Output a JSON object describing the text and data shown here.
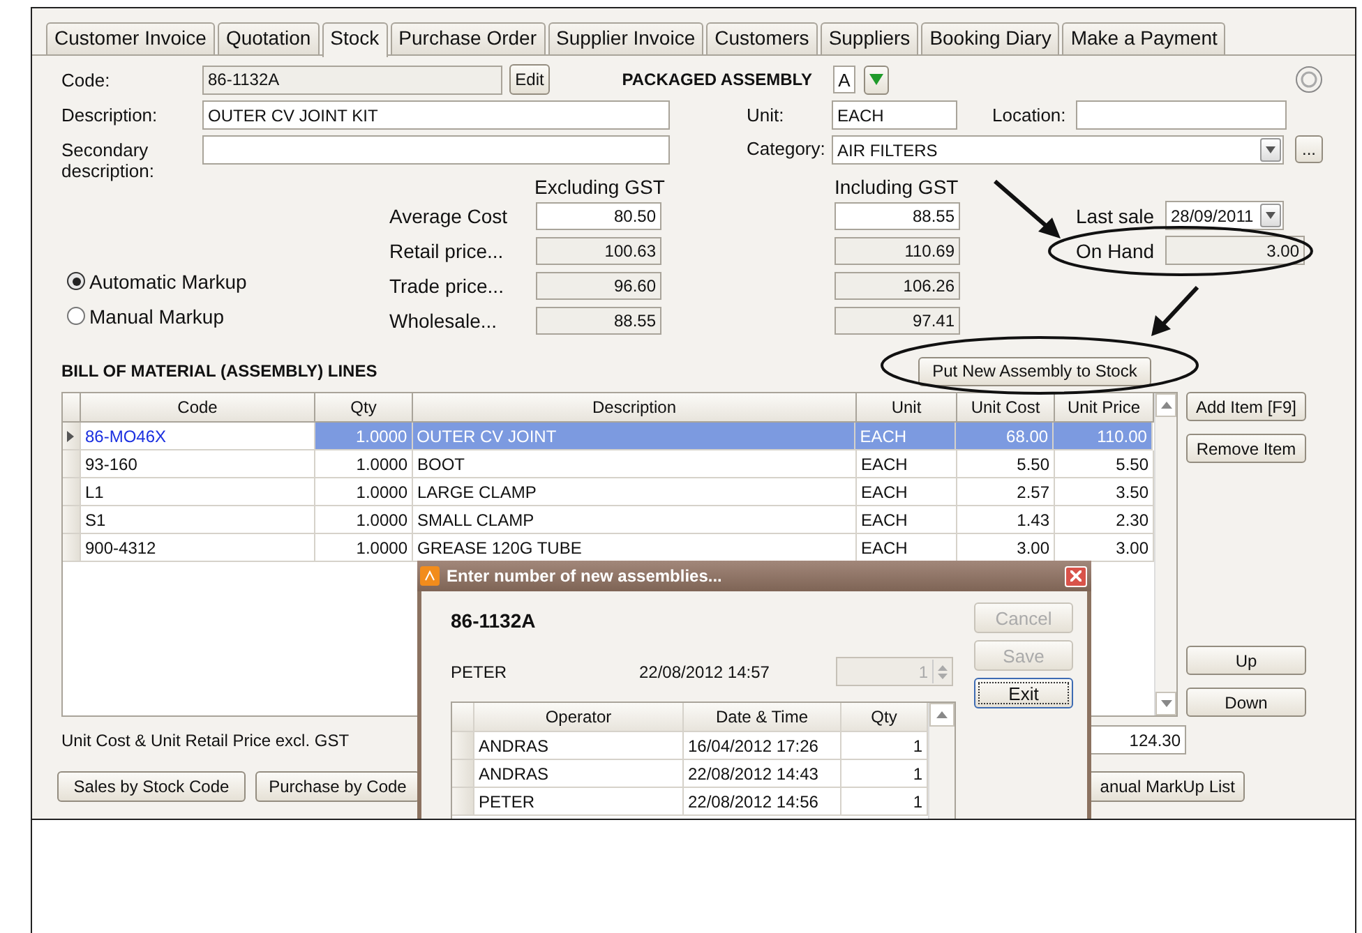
{
  "tabs": [
    {
      "label": "Customer Invoice",
      "selected": false
    },
    {
      "label": "Quotation",
      "selected": false
    },
    {
      "label": "Stock",
      "selected": true
    },
    {
      "label": "Purchase Order",
      "selected": false
    },
    {
      "label": "Supplier Invoice",
      "selected": false
    },
    {
      "label": "Customers",
      "selected": false
    },
    {
      "label": "Suppliers",
      "selected": false
    },
    {
      "label": "Booking Diary",
      "selected": false
    },
    {
      "label": "Make a Payment",
      "selected": false
    }
  ],
  "stock": {
    "code_label": "Code:",
    "code": "86-1132A",
    "edit_button": "Edit",
    "type_label": "PACKAGED ASSEMBLY",
    "type_code": "A",
    "description_label": "Description:",
    "description": "OUTER CV JOINT KIT",
    "unit_label": "Unit:",
    "unit": "EACH",
    "location_label": "Location:",
    "secondary_description_label": "Secondary description:",
    "category_label": "Category:",
    "category": "AIR FILTERS",
    "more_button": "...",
    "excluding_header": "Excluding GST",
    "including_header": "Including GST",
    "prices": [
      {
        "label": "Average Cost",
        "excluding": "80.50",
        "including": "88.55",
        "editable": true
      },
      {
        "label": "Retail price...",
        "excluding": "100.63",
        "including": "110.69",
        "editable": false
      },
      {
        "label": "Trade price...",
        "excluding": "96.60",
        "including": "106.26",
        "editable": false
      },
      {
        "label": "Wholesale...",
        "excluding": "88.55",
        "including": "97.41",
        "editable": false
      }
    ],
    "markup_options": [
      {
        "label": "Automatic Markup",
        "selected": true
      },
      {
        "label": "Manual Markup",
        "selected": false
      }
    ],
    "last_sale_label": "Last sale",
    "last_sale": "28/09/2011",
    "on_hand_label": "On Hand",
    "on_hand": "3.00"
  },
  "bom": {
    "title": "BILL OF MATERIAL (ASSEMBLY) LINES",
    "action_button": "Put New Assembly to Stock",
    "columns": [
      "Code",
      "Qty",
      "Description",
      "Unit",
      "Unit Cost",
      "Unit Price"
    ],
    "rows": [
      {
        "code": "86-MO46X",
        "qty": "1.0000",
        "description": "OUTER CV JOINT",
        "unit": "EACH",
        "unit_cost": "68.00",
        "unit_price": "110.00",
        "selected": true
      },
      {
        "code": "93-160",
        "qty": "1.0000",
        "description": "BOOT",
        "unit": "EACH",
        "unit_cost": "5.50",
        "unit_price": "5.50",
        "selected": false
      },
      {
        "code": "L1",
        "qty": "1.0000",
        "description": "LARGE CLAMP",
        "unit": "EACH",
        "unit_cost": "2.57",
        "unit_price": "3.50",
        "selected": false
      },
      {
        "code": "S1",
        "qty": "1.0000",
        "description": "SMALL CLAMP",
        "unit": "EACH",
        "unit_cost": "1.43",
        "unit_price": "2.30",
        "selected": false
      },
      {
        "code": "900-4312",
        "qty": "1.0000",
        "description": "GREASE 120G TUBE",
        "unit": "EACH",
        "unit_cost": "3.00",
        "unit_price": "3.00",
        "selected": false
      }
    ],
    "side_buttons": [
      "Add Item [F9]",
      "Remove Item"
    ],
    "nav_buttons": [
      "Up",
      "Down"
    ]
  },
  "footer": {
    "note": "Unit Cost & Unit Retail Price excl. GST",
    "total": "124.30",
    "buttons": [
      "Sales by Stock Code",
      "Purchase by Code",
      "anual MarkUp List"
    ]
  },
  "dialog": {
    "title": "Enter number of new assemblies...",
    "code": "86-1132A",
    "operator": "PETER",
    "timestamp": "22/08/2012 14:57",
    "qty": "1",
    "buttons": [
      {
        "label": "Cancel",
        "disabled": true
      },
      {
        "label": "Save",
        "disabled": true
      },
      {
        "label": "Exit",
        "disabled": false
      }
    ],
    "columns": [
      "Operator",
      "Date & Time",
      "Qty"
    ],
    "rows": [
      {
        "operator": "ANDRAS",
        "date_time": "16/04/2012 17:26",
        "qty": "1"
      },
      {
        "operator": "ANDRAS",
        "date_time": "22/08/2012 14:43",
        "qty": "1"
      },
      {
        "operator": "PETER",
        "date_time": "22/08/2012 14:56",
        "qty": "1"
      }
    ]
  }
}
